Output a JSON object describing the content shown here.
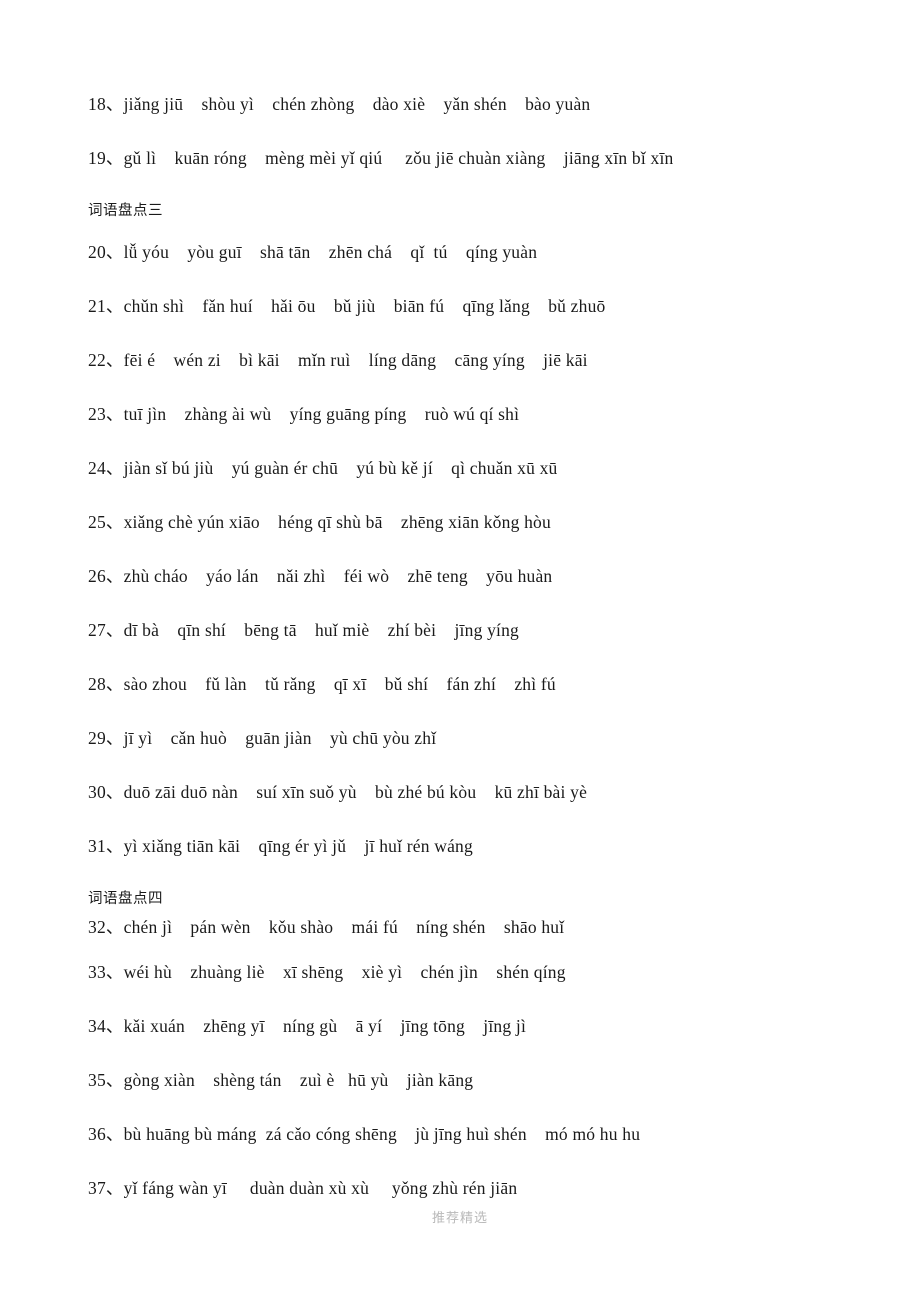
{
  "document": {
    "type": "pinyin-worksheet",
    "watermark": "推荐精选",
    "blocks": [
      {
        "kind": "line",
        "number": "18",
        "sep": "、",
        "text": "18、jiǎng jiū    shòu yì    chén zhòng    dào xiè    yǎn shén    bào yuàn"
      },
      {
        "kind": "line",
        "number": "19",
        "sep": "、",
        "text": "19、gǔ lì    kuān róng    mèng mèi yǐ qiú     zǒu jiē chuàn xiàng    jiāng xīn bǐ xīn"
      },
      {
        "kind": "heading",
        "number": "",
        "sep": "",
        "text": "词语盘点三"
      },
      {
        "kind": "line",
        "number": "20",
        "sep": "、",
        "text": "20、lǚ yóu    yòu guī    shā tān    zhēn chá    qǐ  tú    qíng yuàn"
      },
      {
        "kind": "line",
        "number": "21",
        "sep": "、",
        "text": "21、chǔn shì    fǎn huí    hǎi ōu    bǔ jiù    biān fú    qīng lǎng    bǔ zhuō"
      },
      {
        "kind": "line",
        "number": "22",
        "sep": "、",
        "text": "22、fēi é    wén zi    bì kāi    mǐn ruì    líng dāng    cāng yíng    jiē kāi"
      },
      {
        "kind": "line",
        "number": "23",
        "sep": "、",
        "text": "23、tuī jìn    zhàng ài wù    yíng guāng píng    ruò wú qí shì"
      },
      {
        "kind": "line",
        "number": "24",
        "sep": "、",
        "text": "24、jiàn sǐ bú jiù    yú guàn ér chū    yú bù kě jí    qì chuǎn xū xū"
      },
      {
        "kind": "line",
        "number": "25",
        "sep": "、",
        "text": "25、xiǎng chè yún xiāo    héng qī shù bā    zhēng xiān kǒng hòu"
      },
      {
        "kind": "line",
        "number": "26",
        "sep": "、",
        "text": "26、zhù cháo    yáo lán    nǎi zhì    féi wò    zhē teng    yōu huàn"
      },
      {
        "kind": "line",
        "number": "27",
        "sep": "、",
        "text": "27、dī bà    qīn shí    bēng tā    huǐ miè    zhí bèi    jīng yíng"
      },
      {
        "kind": "line",
        "number": "28",
        "sep": "、",
        "text": "28、sào zhou    fǔ làn    tǔ rǎng    qī xī    bǔ shí    fán zhí    zhì fú"
      },
      {
        "kind": "line",
        "number": "29",
        "sep": "、",
        "text": "29、jī yì    cǎn huò    guān jiàn    yù chū yòu zhǐ"
      },
      {
        "kind": "line",
        "number": "30",
        "sep": "、",
        "text": "30、duō zāi duō nàn    suí xīn suǒ yù    bù zhé bú kòu    kū zhī bài yè"
      },
      {
        "kind": "line",
        "number": "31",
        "sep": "、",
        "text": "31、yì xiǎng tiān kāi    qīng ér yì jǔ    jī huǐ rén wáng"
      },
      {
        "kind": "heading",
        "number": "",
        "sep": "",
        "text": "词语盘点四"
      },
      {
        "kind": "line",
        "number": "32",
        "sep": "、",
        "text": "32、chén jì    pán wèn    kǒu shào    mái fú    níng shén    shāo huǐ"
      },
      {
        "kind": "line",
        "number": "33",
        "sep": "、",
        "text": "33、wéi hù    zhuàng liè    xī shēng    xiè yì    chén jìn    shén qíng"
      },
      {
        "kind": "line",
        "number": "34",
        "sep": "、",
        "text": "34、kǎi xuán    zhēng yī    níng gù    ā yí    jīng tōng    jīng jì"
      },
      {
        "kind": "line",
        "number": "35",
        "sep": "、",
        "text": "35、gòng xiàn    shèng tán    zuì è   hū yù    jiàn kāng"
      },
      {
        "kind": "line",
        "number": "36",
        "sep": "、",
        "text": "36、bù huāng bù máng  zá cǎo cóng shēng    jù jīng huì shén    mó mó hu hu"
      },
      {
        "kind": "line",
        "number": "37",
        "sep": "、",
        "text": "37、yǐ fáng wàn yī     duàn duàn xù xù     yǒng zhù rén jiān"
      }
    ],
    "lines_detail": [
      {
        "number": "18",
        "words": [
          "jiǎng jiū",
          "shòu yì",
          "chén zhòng",
          "dào xiè",
          "yǎn shén",
          "bào yuàn"
        ]
      },
      {
        "number": "19",
        "words": [
          "gǔ lì",
          "kuān róng",
          "mèng mèi yǐ qiú",
          "zǒu jiē chuàn xiàng",
          "jiāng xīn bǐ xīn"
        ]
      },
      {
        "number": "20",
        "words": [
          "lǚ yóu",
          "yòu guī",
          "shā tān",
          "zhēn chá",
          "qǐ tú",
          "qíng yuàn"
        ]
      },
      {
        "number": "21",
        "words": [
          "chǔn shì",
          "fǎn huí",
          "hǎi ōu",
          "bǔ jiù",
          "biān fú",
          "qīng lǎng",
          "bǔ zhuō"
        ]
      },
      {
        "number": "22",
        "words": [
          "fēi é",
          "wén zi",
          "bì kāi",
          "mǐn ruì",
          "líng dāng",
          "cāng yíng",
          "jiē kāi"
        ]
      },
      {
        "number": "23",
        "words": [
          "tuī jìn",
          "zhàng ài wù",
          "yíng guāng píng",
          "ruò wú qí shì"
        ]
      },
      {
        "number": "24",
        "words": [
          "jiàn sǐ bú jiù",
          "yú guàn ér chū",
          "yú bù kě jí",
          "qì chuǎn xū xū"
        ]
      },
      {
        "number": "25",
        "words": [
          "xiǎng chè yún xiāo",
          "héng qī shù bā",
          "zhēng xiān kǒng hòu"
        ]
      },
      {
        "number": "26",
        "words": [
          "zhù cháo",
          "yáo lán",
          "nǎi zhì",
          "féi wò",
          "zhē teng",
          "yōu huàn"
        ]
      },
      {
        "number": "27",
        "words": [
          "dī bà",
          "qīn shí",
          "bēng tā",
          "huǐ miè",
          "zhí bèi",
          "jīng yíng"
        ]
      },
      {
        "number": "28",
        "words": [
          "sào zhou",
          "fǔ làn",
          "tǔ rǎng",
          "qī xī",
          "bǔ shí",
          "fán zhí",
          "zhì fú"
        ]
      },
      {
        "number": "29",
        "words": [
          "jī yì",
          "cǎn huò",
          "guān jiàn",
          "yù chū yòu zhǐ"
        ]
      },
      {
        "number": "30",
        "words": [
          "duō zāi duō nàn",
          "suí xīn suǒ yù",
          "bù zhé bú kòu",
          "kū zhī bài yè"
        ]
      },
      {
        "number": "31",
        "words": [
          "yì xiǎng tiān kāi",
          "qīng ér yì jǔ",
          "jī huǐ rén wáng"
        ]
      },
      {
        "number": "32",
        "words": [
          "chén jì",
          "pán wèn",
          "kǒu shào",
          "mái fú",
          "níng shén",
          "shāo huǐ"
        ]
      },
      {
        "number": "33",
        "words": [
          "wéi hù",
          "zhuàng liè",
          "xī shēng",
          "xiè yì",
          "chén jìn",
          "shén qíng"
        ]
      },
      {
        "number": "34",
        "words": [
          "kǎi xuán",
          "zhēng yī",
          "níng gù",
          "ā yí",
          "jīng tōng",
          "jīng jì"
        ]
      },
      {
        "number": "35",
        "words": [
          "gòng xiàn",
          "shèng tán",
          "zuì è",
          "hū yù",
          "jiàn kāng"
        ]
      },
      {
        "number": "36",
        "words": [
          "bù huāng bù máng",
          "zá cǎo cóng shēng",
          "jù jīng huì shén",
          "mó mó hu hu"
        ]
      },
      {
        "number": "37",
        "words": [
          "yǐ fáng wàn yī",
          "duàn duàn xù xù",
          "yǒng zhù rén jiān"
        ]
      }
    ]
  }
}
